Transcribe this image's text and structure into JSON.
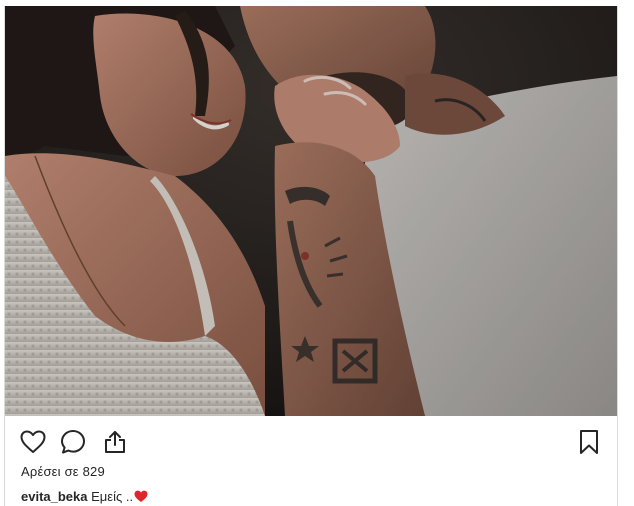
{
  "post": {
    "photo_alt": "",
    "actions": {
      "like_icon": "heart-outline-icon",
      "comment_icon": "comment-bubble-icon",
      "share_icon": "share-upload-icon",
      "save_icon": "bookmark-icon"
    },
    "likes": {
      "prefix": "Αρέσει σε",
      "count": "829"
    },
    "caption": {
      "username": "evita_beka",
      "text": "Εμείς ..",
      "emoji": "red-heart",
      "emoji_color": "#e0262d"
    }
  },
  "colors": {
    "icon": "#262626",
    "border": "#dbdbdb",
    "text": "#262626"
  }
}
